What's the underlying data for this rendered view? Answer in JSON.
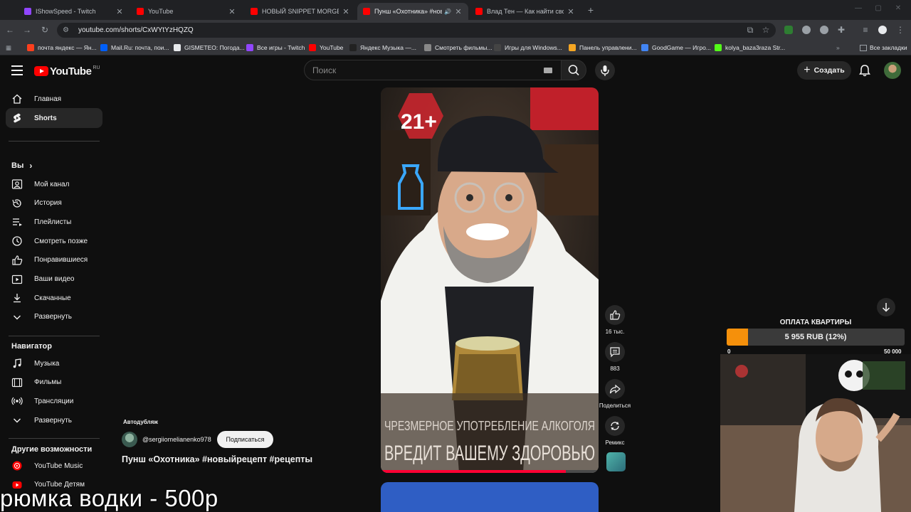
{
  "browser": {
    "tabs": [
      {
        "label": "IShowSpeed - Twitch",
        "favicon_color": "#9146ff",
        "active": false
      },
      {
        "label": "YouTube",
        "favicon_color": "#ff0000",
        "active": false
      },
      {
        "label": "НОВЫЙ SNIPPET MORGENSHT",
        "favicon_color": "#ff0000",
        "active": false
      },
      {
        "label": "Пунш «Охотника» #новый",
        "favicon_color": "#ff0000",
        "active": true
      },
      {
        "label": "Влад Тен — Как найти свой п",
        "favicon_color": "#ff0000",
        "active": false
      }
    ],
    "new_tab": "+",
    "url": "youtube.com/shorts/CxWYtYzHQZQ",
    "bookmarks": [
      {
        "label": "почта яндекс — Ян...",
        "color": "#fc3f1d"
      },
      {
        "label": "Mail.Ru: почта, пои...",
        "color": "#005ff9"
      },
      {
        "label": "GISMETEO: Погода...",
        "color": "#e8eaed"
      },
      {
        "label": "Все игры - Twitch",
        "color": "#9146ff"
      },
      {
        "label": "YouTube",
        "color": "#ff0000"
      },
      {
        "label": "Яндекс Музыка —...",
        "color": "#222222"
      },
      {
        "label": "Смотреть фильмы...",
        "color": "#888888"
      },
      {
        "label": "Игры для Windows...",
        "color": "#444444"
      },
      {
        "label": "Панель управлени...",
        "color": "#f5a623"
      },
      {
        "label": "GoodGame — Игро...",
        "color": "#4285f4"
      },
      {
        "label": "kolya_baza3raza Str...",
        "color": "#53fc18"
      }
    ],
    "bookmarks_more": "»",
    "all_bookmarks": "Все закладки"
  },
  "youtube": {
    "logo_text": "YouTube",
    "logo_region": "RU",
    "search_placeholder": "Поиск",
    "create_label": "Создать",
    "sidebar": {
      "main": [
        {
          "label": "Главная",
          "icon": "home-icon",
          "active": false
        },
        {
          "label": "Shorts",
          "icon": "shorts-icon",
          "active": true
        }
      ],
      "you_header": "Вы",
      "you": [
        {
          "label": "Мой канал",
          "icon": "channel-icon"
        },
        {
          "label": "История",
          "icon": "history-icon"
        },
        {
          "label": "Плейлисты",
          "icon": "playlists-icon"
        },
        {
          "label": "Смотреть позже",
          "icon": "clock-icon"
        },
        {
          "label": "Понравившиеся",
          "icon": "like-icon"
        },
        {
          "label": "Ваши видео",
          "icon": "video-icon"
        },
        {
          "label": "Скачанные",
          "icon": "download-icon"
        },
        {
          "label": "Развернуть",
          "icon": "chevron-down-icon"
        }
      ],
      "nav_header": "Навигатор",
      "nav": [
        {
          "label": "Музыка",
          "icon": "music-icon"
        },
        {
          "label": "Фильмы",
          "icon": "film-icon"
        },
        {
          "label": "Трансляции",
          "icon": "live-icon"
        },
        {
          "label": "Развернуть",
          "icon": "chevron-down-icon"
        }
      ],
      "more_header": "Другие возможности",
      "more": [
        {
          "label": "YouTube Music",
          "icon": "youtube-music-icon"
        },
        {
          "label": "YouTube Детям",
          "icon": "youtube-kids-icon"
        }
      ]
    },
    "short": {
      "age_badge": "21+",
      "warning_line1": "ЧРЕЗМЕРНОЕ УПОТРЕБЛЕНИЕ АЛКОГОЛЯ",
      "warning_line2": "ВРЕДИТ ВАШЕМУ ЗДОРОВЬЮ",
      "progress": 0.85,
      "meta_label": "Автодубляж",
      "channel": "@sergiiomelianenko978",
      "subscribe": "Подписаться",
      "title": "Пунш «Охотника» #новыйрецепт #рецепты",
      "likes": "16 тыс.",
      "comments": "883",
      "share": "Поделиться",
      "remix": "Ремикс"
    }
  },
  "stream_overlay": {
    "donation_title": "ОПЛАТА КВАРТИРЫ",
    "donation_amount": "5 955 RUB (12%)",
    "donation_fraction": 0.12,
    "donation_min": "0",
    "donation_max": "50 000",
    "caption": "рюмка водки - 500р",
    "accent": "#f5900b"
  }
}
